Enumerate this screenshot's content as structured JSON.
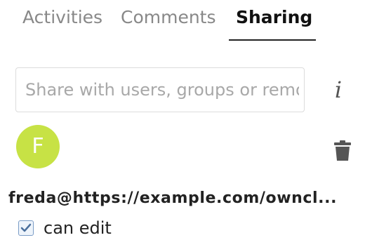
{
  "tabs": {
    "activities": "Activities",
    "comments": "Comments",
    "sharing": "Sharing",
    "active": "sharing"
  },
  "share_input": {
    "placeholder": "Share with users, groups or remote users…",
    "value": ""
  },
  "info_icon": {
    "glyph": "i",
    "icon": "info-icon"
  },
  "share_entry": {
    "avatar_initial": "F",
    "avatar_color": "#c7e245",
    "user": "freda@https://example.com/owncl...",
    "delete_icon": "trash-icon",
    "permission_label": "can edit",
    "permission_checked": true
  }
}
